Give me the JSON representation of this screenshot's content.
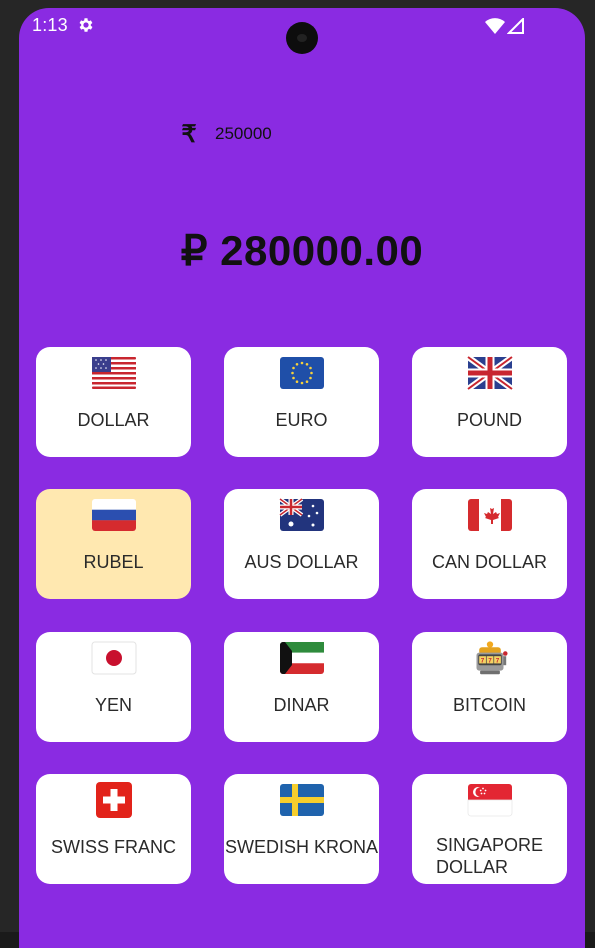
{
  "status_bar": {
    "time": "1:13",
    "settings_icon": "gear-icon",
    "wifi_icon": "wifi-icon",
    "signal_icon": "signal-icon"
  },
  "converter": {
    "input_currency_icon": "rupee-icon",
    "input_symbol": "₹",
    "amount": "250000",
    "result": "₽ 280000.00"
  },
  "selected_currency": "RUBEL",
  "selected_color": "#ffe8b0",
  "background_color": "#8a2be2",
  "currencies": [
    {
      "label": "DOLLAR",
      "flag": "us-flag-icon"
    },
    {
      "label": "EURO",
      "flag": "eu-flag-icon"
    },
    {
      "label": "POUND",
      "flag": "uk-flag-icon"
    },
    {
      "label": "RUBEL",
      "flag": "russia-flag-icon"
    },
    {
      "label": "AUS DOLLAR",
      "flag": "australia-flag-icon"
    },
    {
      "label": "CAN DOLLAR",
      "flag": "canada-flag-icon"
    },
    {
      "label": "YEN",
      "flag": "japan-flag-icon"
    },
    {
      "label": "DINAR",
      "flag": "kuwait-flag-icon"
    },
    {
      "label": "BITCOIN",
      "flag": "slot-machine-icon"
    },
    {
      "label": "SWISS FRANC",
      "flag": "switzerland-flag-icon"
    },
    {
      "label": "SWEDISH KRONA",
      "flag": "sweden-flag-icon"
    },
    {
      "label": "SINGAPORE DOLLAR",
      "flag": "singapore-flag-icon"
    }
  ]
}
